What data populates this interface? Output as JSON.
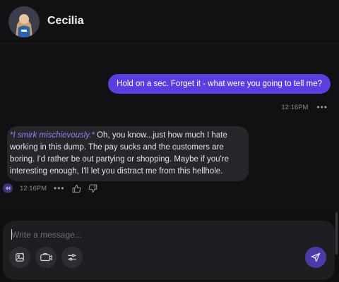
{
  "header": {
    "character_name": "Cecilia",
    "avatar_icon": "character-avatar"
  },
  "messages": {
    "user": {
      "text": "Hold on a sec. Forget it - what were you going to tell me?",
      "time": "12:16PM",
      "more_label": "•••"
    },
    "bot": {
      "action": "*I smirk mischievously.*",
      "text": " Oh, you know...just how much I hate working in this dump. The pay sucks and the customers are boring. I'd rather be out partying or shopping. Maybe if you're interesting enough, I'll let you distract me from this hellhole.",
      "time": "12:16PM",
      "more_label": "•••"
    }
  },
  "composer": {
    "placeholder": "Write a message...",
    "tools": [
      "image-generate-icon",
      "camera-icon",
      "settings-sliders-icon"
    ],
    "send_icon": "send-icon"
  },
  "colors": {
    "accent": "#5b3ee0",
    "action_text": "#9e7df5",
    "background": "#0f0f10"
  }
}
